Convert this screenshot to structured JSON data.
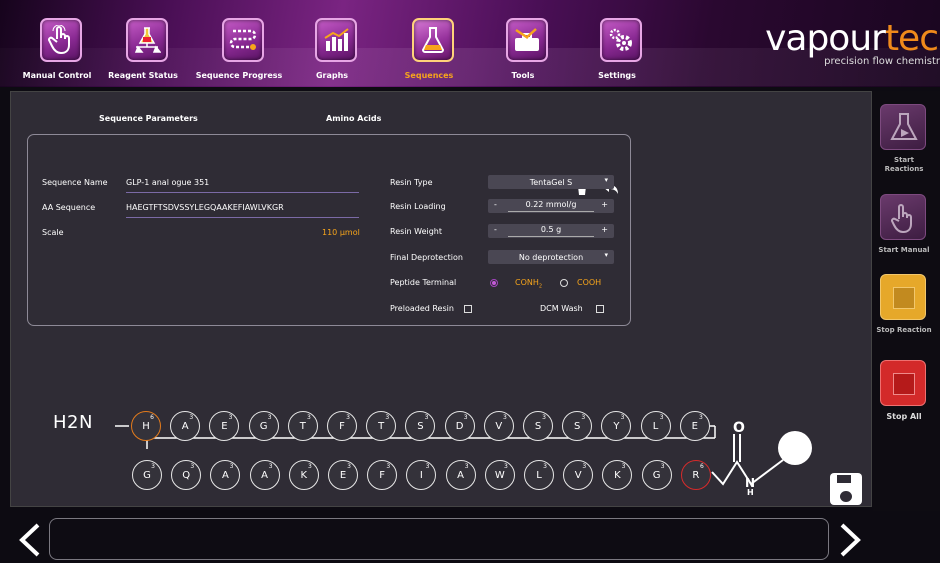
{
  "toolbar": {
    "items": [
      {
        "label": "Manual Control",
        "icon": "hand-touch-icon",
        "active": false
      },
      {
        "label": "Reagent Status",
        "icon": "flask-scale-icon",
        "active": false
      },
      {
        "label": "Sequence Progress",
        "icon": "sequence-progress-icon",
        "active": false
      },
      {
        "label": "Graphs",
        "icon": "bar-chart-icon",
        "active": false
      },
      {
        "label": "Sequences",
        "icon": "flask-icon",
        "active": true
      },
      {
        "label": "Tools",
        "icon": "toolbox-icon",
        "active": false
      },
      {
        "label": "Settings",
        "icon": "gear-icon",
        "active": false
      }
    ]
  },
  "brand": {
    "name_accent": "vapour",
    "name_rest": "tec",
    "tagline": "precision flow chemistr"
  },
  "tabs": {
    "params": "Sequence Parameters",
    "amino": "Amino Acids"
  },
  "form": {
    "seq_name_label": "Sequence Name",
    "seq_name_value": "GLP-1 anal ogue 351",
    "aa_seq_label": "AA Sequence",
    "aa_seq_value": "HAEGTFTSDVSSYLEGQAAKEFIAWLVKGR",
    "scale_label": "Scale",
    "scale_value": "110 µmol",
    "resin_type_label": "Resin Type",
    "resin_type_value": "TentaGel S",
    "resin_loading_label": "Resin Loading",
    "resin_loading_value": "0.22 mmol/g",
    "resin_weight_label": "Resin Weight",
    "resin_weight_value": "0.5 g",
    "final_deprot_label": "Final Deprotection",
    "final_deprot_value": "No deprotection",
    "peptide_terminal_label": "Peptide Terminal",
    "terminal_conh2": "CONH",
    "terminal_conh2_sub": "2",
    "terminal_cooh": "COOH",
    "terminal_selected": "CONH2",
    "preloaded_label": "Preloaded Resin",
    "preloaded_checked": false,
    "dcm_wash_label": "DCM Wash",
    "dcm_wash_checked": false
  },
  "chain": {
    "n_terminus": "H2N",
    "row1": [
      {
        "aa": "H",
        "n": "6",
        "style": "orange"
      },
      {
        "aa": "A",
        "n": "3"
      },
      {
        "aa": "E",
        "n": "3"
      },
      {
        "aa": "G",
        "n": "3"
      },
      {
        "aa": "T",
        "n": "3"
      },
      {
        "aa": "F",
        "n": "3"
      },
      {
        "aa": "T",
        "n": "3"
      },
      {
        "aa": "S",
        "n": "3"
      },
      {
        "aa": "D",
        "n": "3"
      },
      {
        "aa": "V",
        "n": "3"
      },
      {
        "aa": "S",
        "n": "3"
      },
      {
        "aa": "S",
        "n": "3"
      },
      {
        "aa": "Y",
        "n": "3"
      },
      {
        "aa": "L",
        "n": "3"
      },
      {
        "aa": "E",
        "n": "3"
      }
    ],
    "row2": [
      {
        "aa": "G",
        "n": "3"
      },
      {
        "aa": "Q",
        "n": "3"
      },
      {
        "aa": "A",
        "n": "3"
      },
      {
        "aa": "A",
        "n": "3"
      },
      {
        "aa": "K",
        "n": "3"
      },
      {
        "aa": "E",
        "n": "3"
      },
      {
        "aa": "F",
        "n": "3"
      },
      {
        "aa": "I",
        "n": "3"
      },
      {
        "aa": "A",
        "n": "3"
      },
      {
        "aa": "W",
        "n": "3"
      },
      {
        "aa": "L",
        "n": "3"
      },
      {
        "aa": "V",
        "n": "3"
      },
      {
        "aa": "K",
        "n": "3"
      },
      {
        "aa": "G",
        "n": "3"
      },
      {
        "aa": "R",
        "n": "6",
        "style": "red"
      }
    ],
    "c_terminus_O": "O",
    "c_terminus_N": "N",
    "c_terminus_H": "H"
  },
  "side": {
    "start_reactions": "Start Reactions",
    "start_manual": "Start Manual",
    "stop_reaction": "Stop Reaction",
    "stop_all": "Stop All"
  },
  "colors": {
    "accent_orange": "#f7a51b",
    "purple": "#8a2a93",
    "stop_yellow": "#e6a82a",
    "stop_red": "#d32a2a"
  }
}
